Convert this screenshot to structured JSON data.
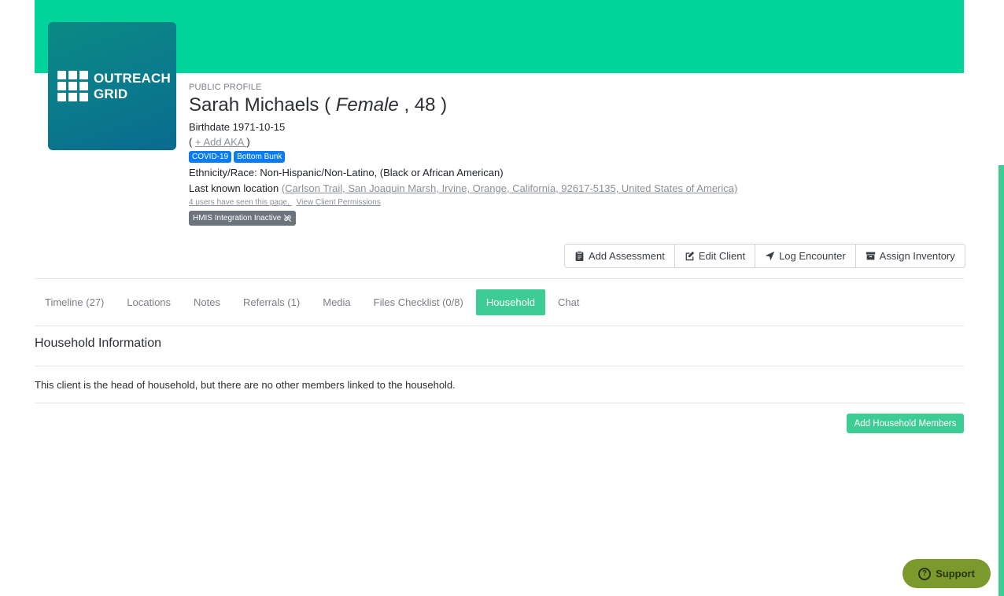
{
  "brand": {
    "logo_line1": "OUTREACH",
    "logo_line2": "GRID",
    "accent_color": "#00d49a",
    "active_tab_color": "#3dcc93"
  },
  "profile": {
    "kicker": "PUBLIC PROFILE",
    "name": "Sarah Michaels",
    "paren_open": " ( ",
    "gender": "Female",
    "age_sep": " , ",
    "age": "48",
    "paren_close": " )",
    "birthdate_label": "Birthdate",
    "birthdate": "1971-10-15",
    "aka_open": "( ",
    "aka_link": "+ Add AKA ",
    "aka_close": ")",
    "badges": [
      "COVID-19",
      "Bottom Bunk"
    ],
    "ethnicity_label": "Ethnicity/Race:",
    "ethnicity": "Non-Hispanic/Non-Latino, (Black or African American)",
    "location_label": "Last known location",
    "location": "(Carlson Trail, San Joaquin Marsh, Irvine, Orange, California, 92617-5135, United States of America)",
    "seen_link": "4 users have seen this page. ",
    "permissions_link": "View Client Permissions",
    "hmis_status": "HMIS Integration Inactive"
  },
  "actions": [
    {
      "label": "Add Assessment",
      "icon": "clipboard-icon"
    },
    {
      "label": "Edit Client",
      "icon": "edit-icon"
    },
    {
      "label": "Log Encounter",
      "icon": "location-arrow-icon"
    },
    {
      "label": "Assign Inventory",
      "icon": "archive-icon"
    }
  ],
  "tabs": [
    {
      "label": "Timeline (27)",
      "active": false
    },
    {
      "label": "Locations",
      "active": false
    },
    {
      "label": "Notes",
      "active": false
    },
    {
      "label": "Referrals (1)",
      "active": false
    },
    {
      "label": "Media",
      "active": false
    },
    {
      "label": "Files Checklist (0/8)",
      "active": false
    },
    {
      "label": "Household",
      "active": true
    },
    {
      "label": "Chat",
      "active": false
    }
  ],
  "household": {
    "title": "Household Information",
    "message": "This client is the head of household, but there are no other members linked to the household.",
    "add_button": "Add Household Members"
  },
  "support": {
    "label": "Support",
    "icon": "question-circle-icon"
  }
}
